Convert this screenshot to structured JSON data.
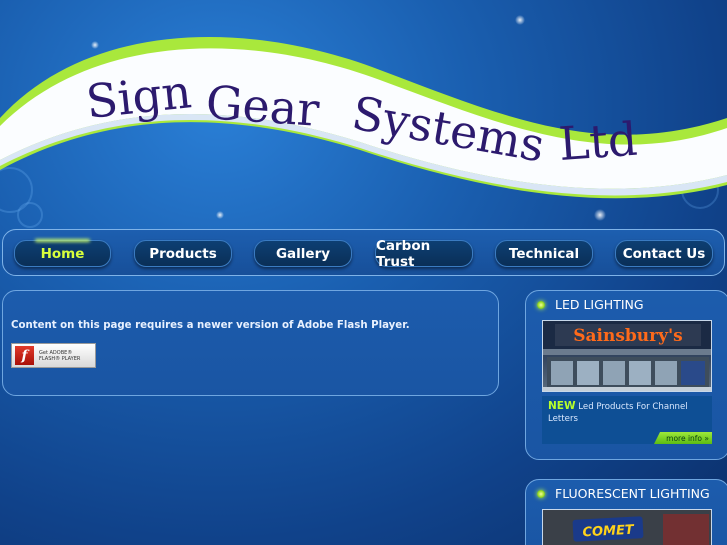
{
  "header": {
    "logo_text": "Sign Gear Systems Ltd"
  },
  "nav": {
    "items": [
      {
        "label": "Home",
        "active": true
      },
      {
        "label": "Products",
        "active": false
      },
      {
        "label": "Gallery",
        "active": false
      },
      {
        "label": "Carbon Trust",
        "active": false
      },
      {
        "label": "Technical",
        "active": false
      },
      {
        "label": "Contact Us",
        "active": false
      }
    ]
  },
  "content": {
    "flash_message": "Content on this page requires a newer version of Adobe Flash Player.",
    "flash_badge": {
      "line1": "Get ADOBE®",
      "line2": "FLASH® PLAYER"
    }
  },
  "sidebar": {
    "led": {
      "title": "LED LIGHTING",
      "image_sign": "Sainsbury's",
      "caption_new": "NEW",
      "caption_text": " Led Products For Channel Letters",
      "more_info": "more info »"
    },
    "fluorescent": {
      "title": "FLUORESCENT LIGHTING",
      "image_sign": "COMET"
    }
  },
  "colors": {
    "accent_green": "#b8ff2a",
    "active_nav": "#d8ff3c",
    "background": "#1a5fb0"
  }
}
